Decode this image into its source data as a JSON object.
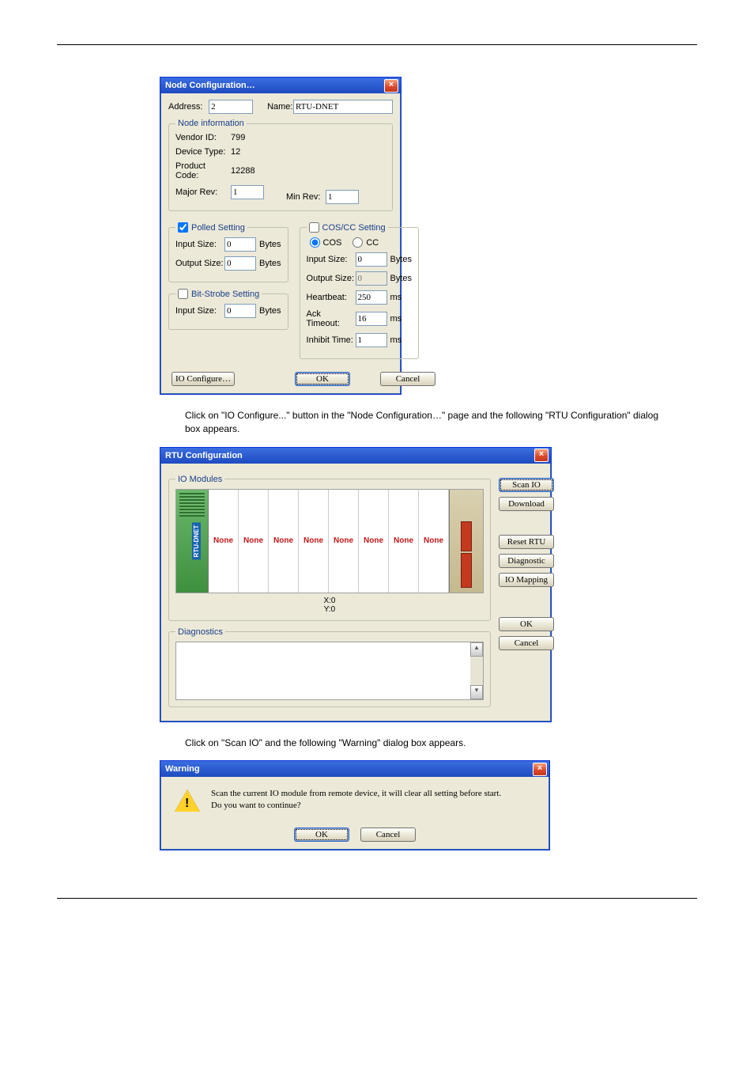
{
  "node_cfg": {
    "title": "Node Configuration…",
    "address_lbl": "Address:",
    "address_val": "2",
    "name_lbl": "Name:",
    "name_val": "RTU-DNET",
    "info": {
      "legend": "Node information",
      "vendor_lbl": "Vendor ID:",
      "vendor_val": "799",
      "devtype_lbl": "Device Type:",
      "devtype_val": "12",
      "prodcode_lbl": "Product Code:",
      "prodcode_val": "12288",
      "major_lbl": "Major Rev:",
      "major_val": "1",
      "min_lbl": "Min Rev:",
      "min_val": "1"
    },
    "polled": {
      "legend": "Polled Setting",
      "checked": true,
      "in_lbl": "Input Size:",
      "in_val": "0",
      "out_lbl": "Output Size:",
      "out_val": "0",
      "unit": "Bytes"
    },
    "bitstrobe": {
      "legend": "Bit-Strobe Setting",
      "checked": false,
      "in_lbl": "Input Size:",
      "in_val": "0",
      "unit": "Bytes"
    },
    "coscc": {
      "legend": "COS/CC Setting",
      "checked": false,
      "cos_lbl": "COS",
      "cc_lbl": "CC",
      "in_lbl": "Input Size:",
      "in_val": "0",
      "out_lbl": "Output Size:",
      "out_val": "0",
      "hb_lbl": "Heartbeat:",
      "hb_val": "250",
      "ack_lbl": "Ack Timeout:",
      "ack_val": "16",
      "inh_lbl": "Inhibit Time:",
      "inh_val": "1",
      "bytes": "Bytes",
      "ms": "ms"
    },
    "buttons": {
      "io": "IO Configure…",
      "ok": "OK",
      "cancel": "Cancel"
    }
  },
  "para1": "Click on \"IO Configure...\" button in the \"Node Configuration…\" page and the following \"RTU Configuration\" dialog box appears.",
  "rtu_cfg": {
    "title": "RTU Configuration",
    "io_legend": "IO Modules",
    "slot_label": "None",
    "rtu_label": "RTU-DNET",
    "xy": {
      "x": "X:0",
      "y": "Y:0"
    },
    "diag_legend": "Diagnostics",
    "buttons": {
      "scan": "Scan IO",
      "download": "Download",
      "reset": "Reset RTU",
      "diagnostic": "Diagnostic",
      "mapping": "IO Mapping",
      "ok": "OK",
      "cancel": "Cancel"
    }
  },
  "para2": "Click on \"Scan IO\" and the following \"Warning\" dialog box appears.",
  "warning": {
    "title": "Warning",
    "line1": "Scan the current IO module from remote device, it will clear all setting before start.",
    "line2": "Do you want to continue?",
    "ok": "OK",
    "cancel": "Cancel"
  }
}
